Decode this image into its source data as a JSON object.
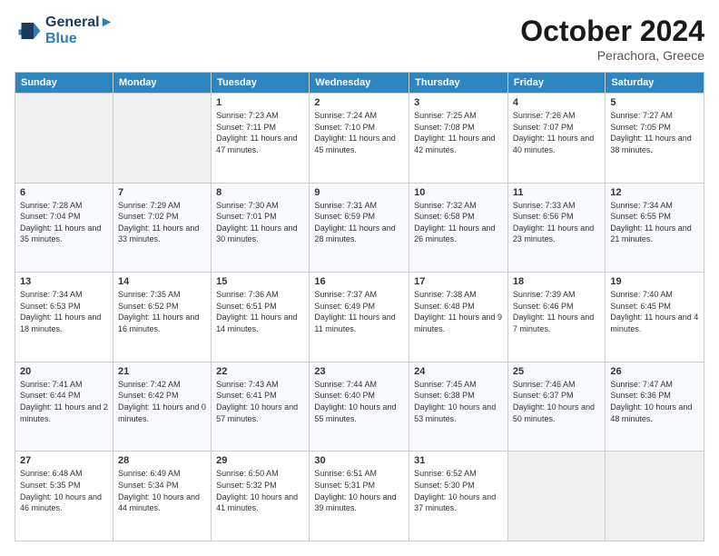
{
  "header": {
    "logo_line1": "General",
    "logo_line2": "Blue",
    "month": "October 2024",
    "location": "Perachora, Greece"
  },
  "days_of_week": [
    "Sunday",
    "Monday",
    "Tuesday",
    "Wednesday",
    "Thursday",
    "Friday",
    "Saturday"
  ],
  "weeks": [
    [
      {
        "day": "",
        "detail": ""
      },
      {
        "day": "",
        "detail": ""
      },
      {
        "day": "1",
        "detail": "Sunrise: 7:23 AM\nSunset: 7:11 PM\nDaylight: 11 hours and 47 minutes."
      },
      {
        "day": "2",
        "detail": "Sunrise: 7:24 AM\nSunset: 7:10 PM\nDaylight: 11 hours and 45 minutes."
      },
      {
        "day": "3",
        "detail": "Sunrise: 7:25 AM\nSunset: 7:08 PM\nDaylight: 11 hours and 42 minutes."
      },
      {
        "day": "4",
        "detail": "Sunrise: 7:26 AM\nSunset: 7:07 PM\nDaylight: 11 hours and 40 minutes."
      },
      {
        "day": "5",
        "detail": "Sunrise: 7:27 AM\nSunset: 7:05 PM\nDaylight: 11 hours and 38 minutes."
      }
    ],
    [
      {
        "day": "6",
        "detail": "Sunrise: 7:28 AM\nSunset: 7:04 PM\nDaylight: 11 hours and 35 minutes."
      },
      {
        "day": "7",
        "detail": "Sunrise: 7:29 AM\nSunset: 7:02 PM\nDaylight: 11 hours and 33 minutes."
      },
      {
        "day": "8",
        "detail": "Sunrise: 7:30 AM\nSunset: 7:01 PM\nDaylight: 11 hours and 30 minutes."
      },
      {
        "day": "9",
        "detail": "Sunrise: 7:31 AM\nSunset: 6:59 PM\nDaylight: 11 hours and 28 minutes."
      },
      {
        "day": "10",
        "detail": "Sunrise: 7:32 AM\nSunset: 6:58 PM\nDaylight: 11 hours and 26 minutes."
      },
      {
        "day": "11",
        "detail": "Sunrise: 7:33 AM\nSunset: 6:56 PM\nDaylight: 11 hours and 23 minutes."
      },
      {
        "day": "12",
        "detail": "Sunrise: 7:34 AM\nSunset: 6:55 PM\nDaylight: 11 hours and 21 minutes."
      }
    ],
    [
      {
        "day": "13",
        "detail": "Sunrise: 7:34 AM\nSunset: 6:53 PM\nDaylight: 11 hours and 18 minutes."
      },
      {
        "day": "14",
        "detail": "Sunrise: 7:35 AM\nSunset: 6:52 PM\nDaylight: 11 hours and 16 minutes."
      },
      {
        "day": "15",
        "detail": "Sunrise: 7:36 AM\nSunset: 6:51 PM\nDaylight: 11 hours and 14 minutes."
      },
      {
        "day": "16",
        "detail": "Sunrise: 7:37 AM\nSunset: 6:49 PM\nDaylight: 11 hours and 11 minutes."
      },
      {
        "day": "17",
        "detail": "Sunrise: 7:38 AM\nSunset: 6:48 PM\nDaylight: 11 hours and 9 minutes."
      },
      {
        "day": "18",
        "detail": "Sunrise: 7:39 AM\nSunset: 6:46 PM\nDaylight: 11 hours and 7 minutes."
      },
      {
        "day": "19",
        "detail": "Sunrise: 7:40 AM\nSunset: 6:45 PM\nDaylight: 11 hours and 4 minutes."
      }
    ],
    [
      {
        "day": "20",
        "detail": "Sunrise: 7:41 AM\nSunset: 6:44 PM\nDaylight: 11 hours and 2 minutes."
      },
      {
        "day": "21",
        "detail": "Sunrise: 7:42 AM\nSunset: 6:42 PM\nDaylight: 11 hours and 0 minutes."
      },
      {
        "day": "22",
        "detail": "Sunrise: 7:43 AM\nSunset: 6:41 PM\nDaylight: 10 hours and 57 minutes."
      },
      {
        "day": "23",
        "detail": "Sunrise: 7:44 AM\nSunset: 6:40 PM\nDaylight: 10 hours and 55 minutes."
      },
      {
        "day": "24",
        "detail": "Sunrise: 7:45 AM\nSunset: 6:38 PM\nDaylight: 10 hours and 53 minutes."
      },
      {
        "day": "25",
        "detail": "Sunrise: 7:46 AM\nSunset: 6:37 PM\nDaylight: 10 hours and 50 minutes."
      },
      {
        "day": "26",
        "detail": "Sunrise: 7:47 AM\nSunset: 6:36 PM\nDaylight: 10 hours and 48 minutes."
      }
    ],
    [
      {
        "day": "27",
        "detail": "Sunrise: 6:48 AM\nSunset: 5:35 PM\nDaylight: 10 hours and 46 minutes."
      },
      {
        "day": "28",
        "detail": "Sunrise: 6:49 AM\nSunset: 5:34 PM\nDaylight: 10 hours and 44 minutes."
      },
      {
        "day": "29",
        "detail": "Sunrise: 6:50 AM\nSunset: 5:32 PM\nDaylight: 10 hours and 41 minutes."
      },
      {
        "day": "30",
        "detail": "Sunrise: 6:51 AM\nSunset: 5:31 PM\nDaylight: 10 hours and 39 minutes."
      },
      {
        "day": "31",
        "detail": "Sunrise: 6:52 AM\nSunset: 5:30 PM\nDaylight: 10 hours and 37 minutes."
      },
      {
        "day": "",
        "detail": ""
      },
      {
        "day": "",
        "detail": ""
      }
    ]
  ]
}
